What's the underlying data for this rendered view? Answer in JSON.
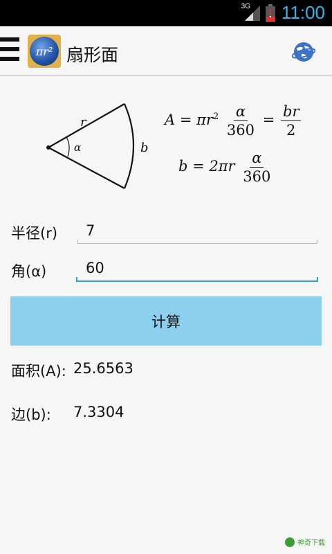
{
  "status_bar": {
    "network": "3G",
    "time": "11:00"
  },
  "action_bar": {
    "title": "扇形面",
    "logo_text": "πr²"
  },
  "diagram": {
    "radius_label": "r",
    "angle_label": "α",
    "arc_label": "b"
  },
  "formulas": {
    "area_lhs": "A = πr",
    "area_sup": "2",
    "alpha": "α",
    "den_360": "360",
    "equals": "=",
    "br": "br",
    "two": "2",
    "arc_lhs": "b = 2πr"
  },
  "form": {
    "radius_label": "半径(r)",
    "radius_value": "7",
    "angle_label": "角(α)",
    "angle_value": "60",
    "calculate_label": "计算"
  },
  "results": {
    "area_label": "面积(A):",
    "area_value": "25.6563",
    "arc_label": "边(b):",
    "arc_value": "7.3304"
  },
  "watermark": {
    "text": "神奇下载"
  },
  "colors": {
    "accent": "#33b5e5",
    "button": "#8ccfee",
    "focus_line": "#33a3c9"
  }
}
